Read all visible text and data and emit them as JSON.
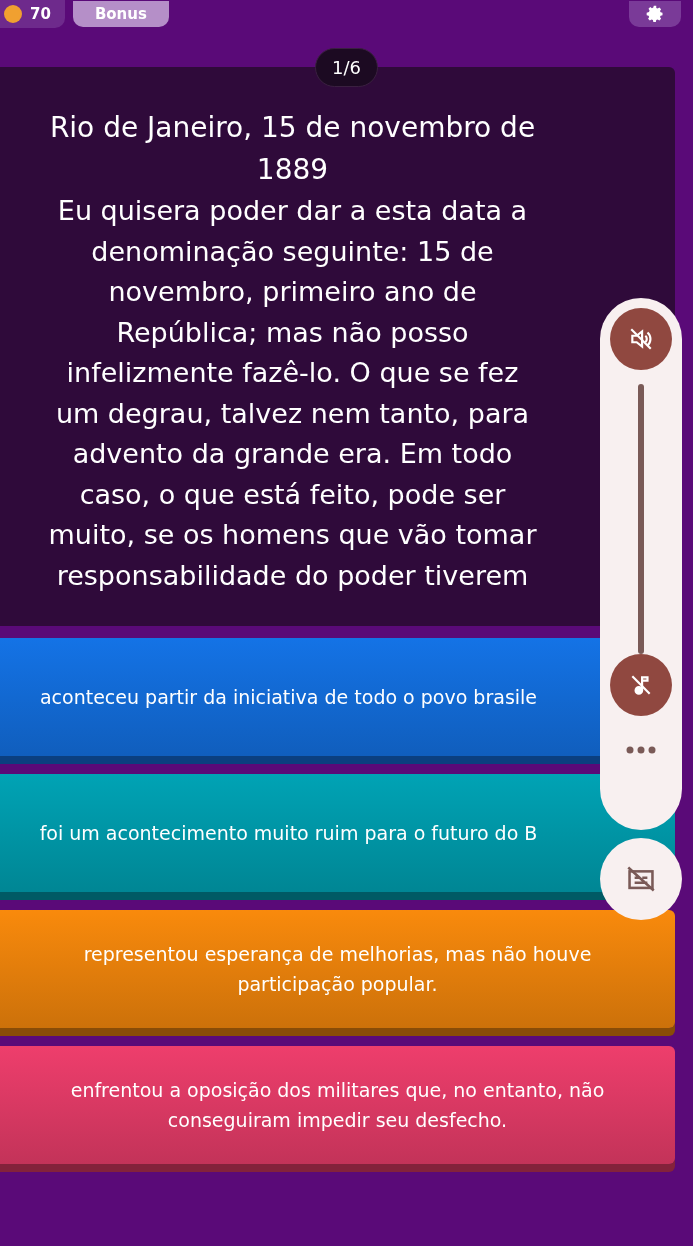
{
  "top_bar": {
    "coins": "70",
    "bonus_button": "Bonus"
  },
  "question_counter": "1/6",
  "passage": {
    "title": "Rio de Janeiro, 15 de novembro de 1889",
    "lines": [
      "Eu quisera poder dar a esta data a",
      "denominação seguinte: 15 de",
      "novembro, primeiro ano de",
      "República; mas não posso",
      "infelizmente fazê-lo. O que se fez",
      "um degrau, talvez nem tanto, para",
      "advento da grande era. Em todo",
      "caso, o que está feito, pode ser",
      "muito, se os homens que vão tomar",
      "responsabilidade do poder tiverem"
    ]
  },
  "answers": [
    {
      "text": "aconteceu partir da iniciativa de todo o povo brasile",
      "color": "#1473e6"
    },
    {
      "text": "foi um acontecimento muito ruim para o futuro do B",
      "color": "#00a3b5"
    },
    {
      "text": "representou esperança de melhorias, mas não houve participação popular.",
      "color": "#f98a0c"
    },
    {
      "text": "enfrentou a oposição dos militares que, no entanto, não conseguiram impedir seu desfecho.",
      "color": "#ee3e6c"
    }
  ],
  "media_panel": {
    "volume": {
      "level": 0
    }
  }
}
